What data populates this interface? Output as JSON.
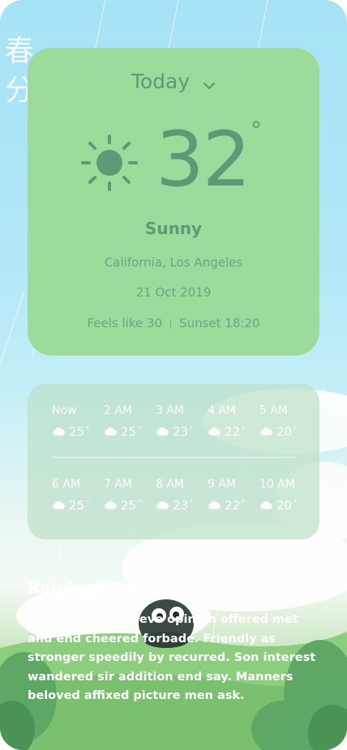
{
  "background": {
    "kanji": "春分"
  },
  "today": {
    "selector_label": "Today",
    "temperature": "32",
    "degree_symbol": "°",
    "condition": "Sunny",
    "location": "California, Los Angeles",
    "date": "21 Oct 2019",
    "feels_like": "Feels like 30",
    "sunset": "Sunset 18:20",
    "icon": "sun-icon"
  },
  "hourly": {
    "icon": "cloud-icon",
    "row1": [
      {
        "time": "Now",
        "temp": "25"
      },
      {
        "time": "2 AM",
        "temp": "25"
      },
      {
        "time": "3 AM",
        "temp": "23"
      },
      {
        "time": "4 AM",
        "temp": "22"
      },
      {
        "time": "5 AM",
        "temp": "20"
      }
    ],
    "row2": [
      {
        "time": "6 AM",
        "temp": "25"
      },
      {
        "time": "7 AM",
        "temp": "25"
      },
      {
        "time": "8 AM",
        "temp": "23"
      },
      {
        "time": "9 AM",
        "temp": "22"
      },
      {
        "time": "10 AM",
        "temp": "20"
      }
    ],
    "degree_symbol": "°"
  },
  "random": {
    "title": "Random Text",
    "body": "Improve him believe opinion offered met and end cheered forbade. Friendly as stronger speedily by recurred. Son interest wandered sir addition end say. Manners beloved affixed picture men ask."
  },
  "colors": {
    "card_today": "#9cdb9c",
    "text_green": "#5d9a75",
    "sky": "#a6e2f6"
  }
}
